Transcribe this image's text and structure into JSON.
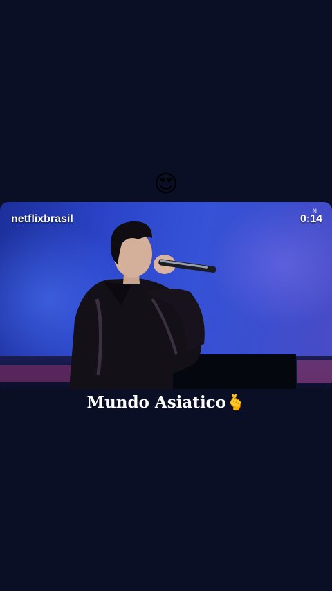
{
  "top_emoji": {
    "glyph": "😍",
    "icon": "heart-eyes-emoji-icon"
  },
  "video": {
    "username": "netflixbrasil",
    "timestamp": "0:14",
    "watermark": "N",
    "colors": {
      "background_blue": "#2b44c8",
      "stage_pink": "#6a2a63"
    }
  },
  "caption": {
    "text": "Mundo Asiatico",
    "emoji": "🫰",
    "emoji_icon": "finger-heart-emoji-icon"
  },
  "colors": {
    "page_background": "#0a0f26",
    "text": "#ffffff"
  }
}
